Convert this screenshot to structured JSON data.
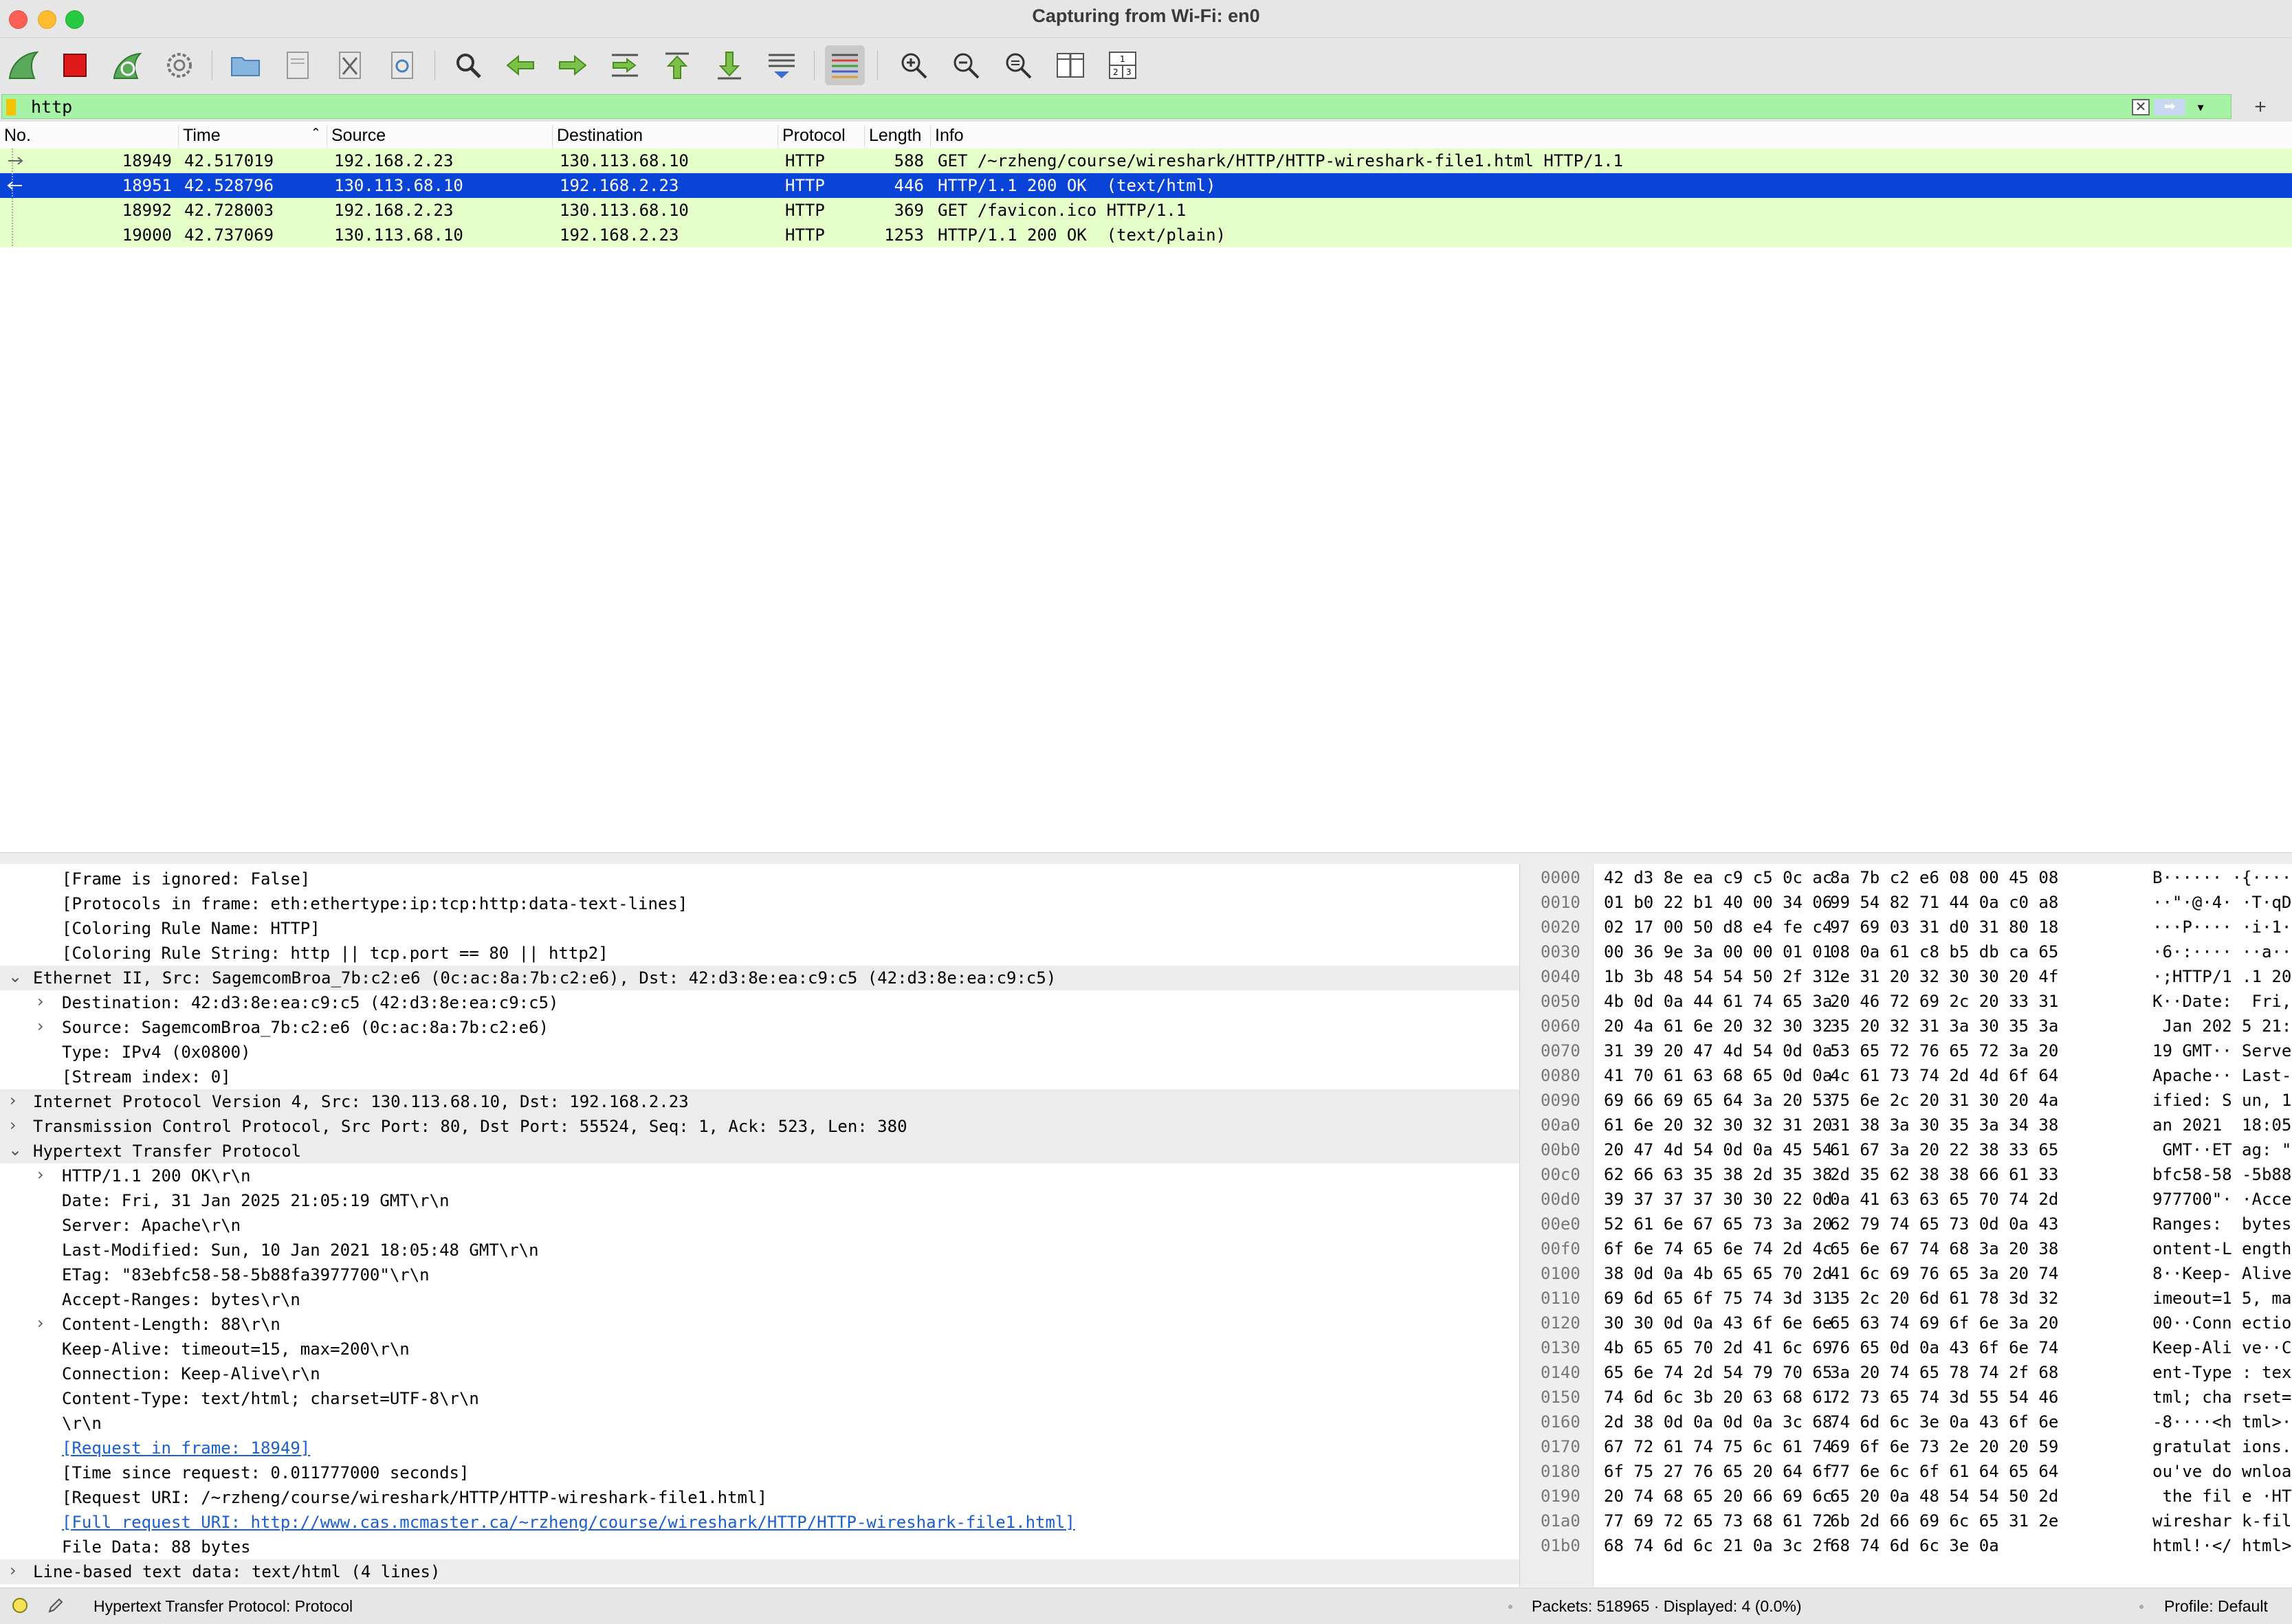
{
  "window": {
    "title": "Capturing from Wi-Fi: en0"
  },
  "toolbar": {
    "buttons": [
      "start-capture",
      "stop-capture",
      "restart-capture",
      "capture-options",
      "open-file",
      "save-file",
      "close-file",
      "reload-file",
      "find-packet",
      "go-back",
      "go-forward",
      "go-to-packet",
      "go-first",
      "go-last",
      "auto-scroll",
      "colorize",
      "zoom-in",
      "zoom-out",
      "zoom-normal",
      "resize-columns",
      "layout"
    ]
  },
  "filter": {
    "value": "http",
    "add_label": "+"
  },
  "packet_list": {
    "columns": [
      "No.",
      "Time",
      "Source",
      "Destination",
      "Protocol",
      "Length",
      "Info"
    ],
    "rows": [
      {
        "no": "18949",
        "time": "42.517019",
        "src": "192.168.2.23",
        "dst": "130.113.68.10",
        "proto": "HTTP",
        "len": "588",
        "info": "GET /~rzheng/course/wireshark/HTTP/HTTP-wireshark-file1.html HTTP/1.1"
      },
      {
        "no": "18951",
        "time": "42.528796",
        "src": "130.113.68.10",
        "dst": "192.168.2.23",
        "proto": "HTTP",
        "len": "446",
        "info": "HTTP/1.1 200 OK  (text/html)"
      },
      {
        "no": "18992",
        "time": "42.728003",
        "src": "192.168.2.23",
        "dst": "130.113.68.10",
        "proto": "HTTP",
        "len": "369",
        "info": "GET /favicon.ico HTTP/1.1"
      },
      {
        "no": "19000",
        "time": "42.737069",
        "src": "130.113.68.10",
        "dst": "192.168.2.23",
        "proto": "HTTP",
        "len": "1253",
        "info": "HTTP/1.1 200 OK  (text/plain)"
      }
    ]
  },
  "details": {
    "lines": [
      {
        "text": "[Frame is ignored: False]"
      },
      {
        "text": "[Protocols in frame: eth:ethertype:ip:tcp:http:data-text-lines]"
      },
      {
        "text": "[Coloring Rule Name: HTTP]"
      },
      {
        "text": "[Coloring Rule String: http || tcp.port == 80 || http2]"
      },
      {
        "text": "Ethernet II, Src: SagemcomBroa_7b:c2:e6 (0c:ac:8a:7b:c2:e6), Dst: 42:d3:8e:ea:c9:c5 (42:d3:8e:ea:c9:c5)"
      },
      {
        "text": "Destination: 42:d3:8e:ea:c9:c5 (42:d3:8e:ea:c9:c5)"
      },
      {
        "text": "Source: SagemcomBroa_7b:c2:e6 (0c:ac:8a:7b:c2:e6)"
      },
      {
        "text": "Type: IPv4 (0x0800)"
      },
      {
        "text": "[Stream index: 0]"
      },
      {
        "text": "Internet Protocol Version 4, Src: 130.113.68.10, Dst: 192.168.2.23"
      },
      {
        "text": "Transmission Control Protocol, Src Port: 80, Dst Port: 55524, Seq: 1, Ack: 523, Len: 380"
      },
      {
        "text": "Hypertext Transfer Protocol"
      },
      {
        "text": "HTTP/1.1 200 OK\\r\\n"
      },
      {
        "text": "Date: Fri, 31 Jan 2025 21:05:19 GMT\\r\\n"
      },
      {
        "text": "Server: Apache\\r\\n"
      },
      {
        "text": "Last-Modified: Sun, 10 Jan 2021 18:05:48 GMT\\r\\n"
      },
      {
        "text": "ETag: \"83ebfc58-58-5b88fa3977700\"\\r\\n"
      },
      {
        "text": "Accept-Ranges: bytes\\r\\n"
      },
      {
        "text": "Content-Length: 88\\r\\n"
      },
      {
        "text": "Keep-Alive: timeout=15, max=200\\r\\n"
      },
      {
        "text": "Connection: Keep-Alive\\r\\n"
      },
      {
        "text": "Content-Type: text/html; charset=UTF-8\\r\\n"
      },
      {
        "text": "\\r\\n"
      },
      {
        "text": "[Request in frame: 18949]"
      },
      {
        "text": "[Time since request: 0.011777000 seconds]"
      },
      {
        "text": "[Request URI: /~rzheng/course/wireshark/HTTP/HTTP-wireshark-file1.html]"
      },
      {
        "text": "[Full request URI: http://www.cas.mcmaster.ca/~rzheng/course/wireshark/HTTP/HTTP-wireshark-file1.html]"
      },
      {
        "text": "File Data: 88 bytes"
      },
      {
        "text": "Line-based text data: text/html (4 lines)"
      }
    ]
  },
  "bytes": {
    "rows": [
      {
        "off": "0000",
        "h1": "42 d3 8e ea c9 c5 0c ac",
        "h2": "8a 7b c2 e6 08 00 45 08",
        "ascii": "B······ ·{····E·"
      },
      {
        "off": "0010",
        "h1": "01 b0 22 b1 40 00 34 06",
        "h2": "99 54 82 71 44 0a c0 a8",
        "ascii": "··\"·@·4· ·T·qD···"
      },
      {
        "off": "0020",
        "h1": "02 17 00 50 d8 e4 fe c4",
        "h2": "97 69 03 31 d0 31 80 18",
        "ascii": "···P···· ·i·1·1··"
      },
      {
        "off": "0030",
        "h1": "00 36 9e 3a 00 00 01 01",
        "h2": "08 0a 61 c8 b5 db ca 65",
        "ascii": "·6·:···· ··a····e"
      },
      {
        "off": "0040",
        "h1": "1b 3b 48 54 54 50 2f 31",
        "h2": "2e 31 20 32 30 30 20 4f",
        "ascii": "·;HTTP/1 .1 200 O"
      },
      {
        "off": "0050",
        "h1": "4b 0d 0a 44 61 74 65 3a",
        "h2": "20 46 72 69 2c 20 33 31",
        "ascii": "K··Date:  Fri, 31"
      },
      {
        "off": "0060",
        "h1": "20 4a 61 6e 20 32 30 32",
        "h2": "35 20 32 31 3a 30 35 3a",
        "ascii": " Jan 202 5 21:05:"
      },
      {
        "off": "0070",
        "h1": "31 39 20 47 4d 54 0d 0a",
        "h2": "53 65 72 76 65 72 3a 20",
        "ascii": "19 GMT·· Server: "
      },
      {
        "off": "0080",
        "h1": "41 70 61 63 68 65 0d 0a",
        "h2": "4c 61 73 74 2d 4d 6f 64",
        "ascii": "Apache·· Last-Mod"
      },
      {
        "off": "0090",
        "h1": "69 66 69 65 64 3a 20 53",
        "h2": "75 6e 2c 20 31 30 20 4a",
        "ascii": "ified: S un, 10 J"
      },
      {
        "off": "00a0",
        "h1": "61 6e 20 32 30 32 31 20",
        "h2": "31 38 3a 30 35 3a 34 38",
        "ascii": "an 2021  18:05:48"
      },
      {
        "off": "00b0",
        "h1": "20 47 4d 54 0d 0a 45 54",
        "h2": "61 67 3a 20 22 38 33 65",
        "ascii": " GMT··ET ag: \"83e"
      },
      {
        "off": "00c0",
        "h1": "62 66 63 35 38 2d 35 38",
        "h2": "2d 35 62 38 38 66 61 33",
        "ascii": "bfc58-58 -5b88fa3"
      },
      {
        "off": "00d0",
        "h1": "39 37 37 37 30 30 22 0d",
        "h2": "0a 41 63 63 65 70 74 2d",
        "ascii": "977700\"· ·Accept-"
      },
      {
        "off": "00e0",
        "h1": "52 61 6e 67 65 73 3a 20",
        "h2": "62 79 74 65 73 0d 0a 43",
        "ascii": "Ranges:  bytes··C"
      },
      {
        "off": "00f0",
        "h1": "6f 6e 74 65 6e 74 2d 4c",
        "h2": "65 6e 67 74 68 3a 20 38",
        "ascii": "ontent-L ength: 8"
      },
      {
        "off": "0100",
        "h1": "38 0d 0a 4b 65 65 70 2d",
        "h2": "41 6c 69 76 65 3a 20 74",
        "ascii": "8··Keep- Alive: t"
      },
      {
        "off": "0110",
        "h1": "69 6d 65 6f 75 74 3d 31",
        "h2": "35 2c 20 6d 61 78 3d 32",
        "ascii": "imeout=1 5, max=2"
      },
      {
        "off": "0120",
        "h1": "30 30 0d 0a 43 6f 6e 6e",
        "h2": "65 63 74 69 6f 6e 3a 20",
        "ascii": "00··Conn ection: "
      },
      {
        "off": "0130",
        "h1": "4b 65 65 70 2d 41 6c 69",
        "h2": "76 65 0d 0a 43 6f 6e 74",
        "ascii": "Keep-Ali ve··Cont"
      },
      {
        "off": "0140",
        "h1": "65 6e 74 2d 54 79 70 65",
        "h2": "3a 20 74 65 78 74 2f 68",
        "ascii": "ent-Type : text/h"
      },
      {
        "off": "0150",
        "h1": "74 6d 6c 3b 20 63 68 61",
        "h2": "72 73 65 74 3d 55 54 46",
        "ascii": "tml; cha rset=UTF"
      },
      {
        "off": "0160",
        "h1": "2d 38 0d 0a 0d 0a 3c 68",
        "h2": "74 6d 6c 3e 0a 43 6f 6e",
        "ascii": "-8····<h tml>·Con"
      },
      {
        "off": "0170",
        "h1": "67 72 61 74 75 6c 61 74",
        "h2": "69 6f 6e 73 2e 20 20 59",
        "ascii": "gratulat ions.  Y"
      },
      {
        "off": "0180",
        "h1": "6f 75 27 76 65 20 64 6f",
        "h2": "77 6e 6c 6f 61 64 65 64",
        "ascii": "ou've do wnloaded"
      },
      {
        "off": "0190",
        "h1": "20 74 68 65 20 66 69 6c",
        "h2": "65 20 0a 48 54 54 50 2d",
        "ascii": " the fil e ·HTTP-"
      },
      {
        "off": "01a0",
        "h1": "77 69 72 65 73 68 61 72",
        "h2": "6b 2d 66 69 6c 65 31 2e",
        "ascii": "wireshar k-file1."
      },
      {
        "off": "01b0",
        "h1": "68 74 6d 6c 21 0a 3c 2f",
        "h2": "68 74 6d 6c 3e 0a",
        "ascii": "html!·</ html>·"
      }
    ]
  },
  "status": {
    "text": "Hypertext Transfer Protocol: Protocol",
    "packets": "Packets: 518965 · Displayed: 4 (0.0%)",
    "profile": "Profile: Default"
  }
}
